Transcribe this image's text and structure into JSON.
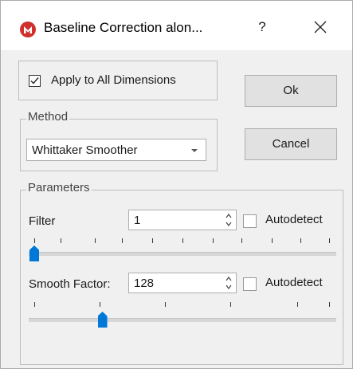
{
  "window": {
    "title": "Baseline Correction alon...",
    "help_label": "?",
    "app_icon": "app-logo-icon",
    "accent": "#d0312d"
  },
  "apply_all": {
    "label": "Apply to All Dimensions",
    "checked": true
  },
  "buttons": {
    "ok": "Ok",
    "cancel": "Cancel"
  },
  "method": {
    "legend": "Method",
    "selected": "Whittaker Smoother"
  },
  "parameters": {
    "legend": "Parameters",
    "filter": {
      "label": "Filter",
      "value": "1",
      "autodetect_label": "Autodetect",
      "autodetect_checked": false,
      "slider_position": 0
    },
    "smooth": {
      "label": "Smooth Factor:",
      "value": "128",
      "autodetect_label": "Autodetect",
      "autodetect_checked": false,
      "slider_position": 0.23
    }
  },
  "colors": {
    "slider_thumb": "#0078d7"
  }
}
